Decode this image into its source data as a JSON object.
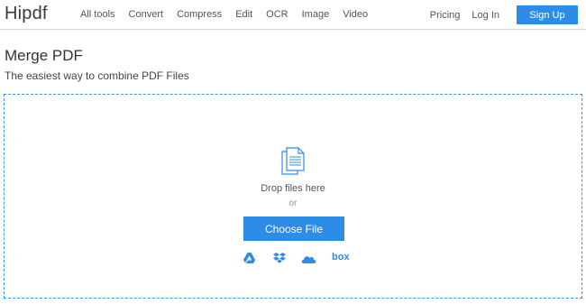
{
  "brand": {
    "logo": "Hipdf",
    "accent": "#2d8ce6"
  },
  "nav": {
    "links": [
      "All tools",
      "Convert",
      "Compress",
      "Edit",
      "OCR",
      "Image",
      "Video"
    ],
    "pricing": "Pricing",
    "login": "Log In",
    "signup": "Sign Up"
  },
  "page": {
    "title": "Merge PDF",
    "subtitle": "The easiest way to combine PDF Files"
  },
  "dropzone": {
    "drop_text": "Drop files here",
    "or_text": "or",
    "choose_button": "Choose File",
    "cloud_sources": [
      {
        "icon": "google-drive-icon"
      },
      {
        "icon": "dropbox-icon"
      },
      {
        "icon": "onedrive-icon"
      },
      {
        "icon": "box-icon",
        "label": "box"
      }
    ]
  }
}
